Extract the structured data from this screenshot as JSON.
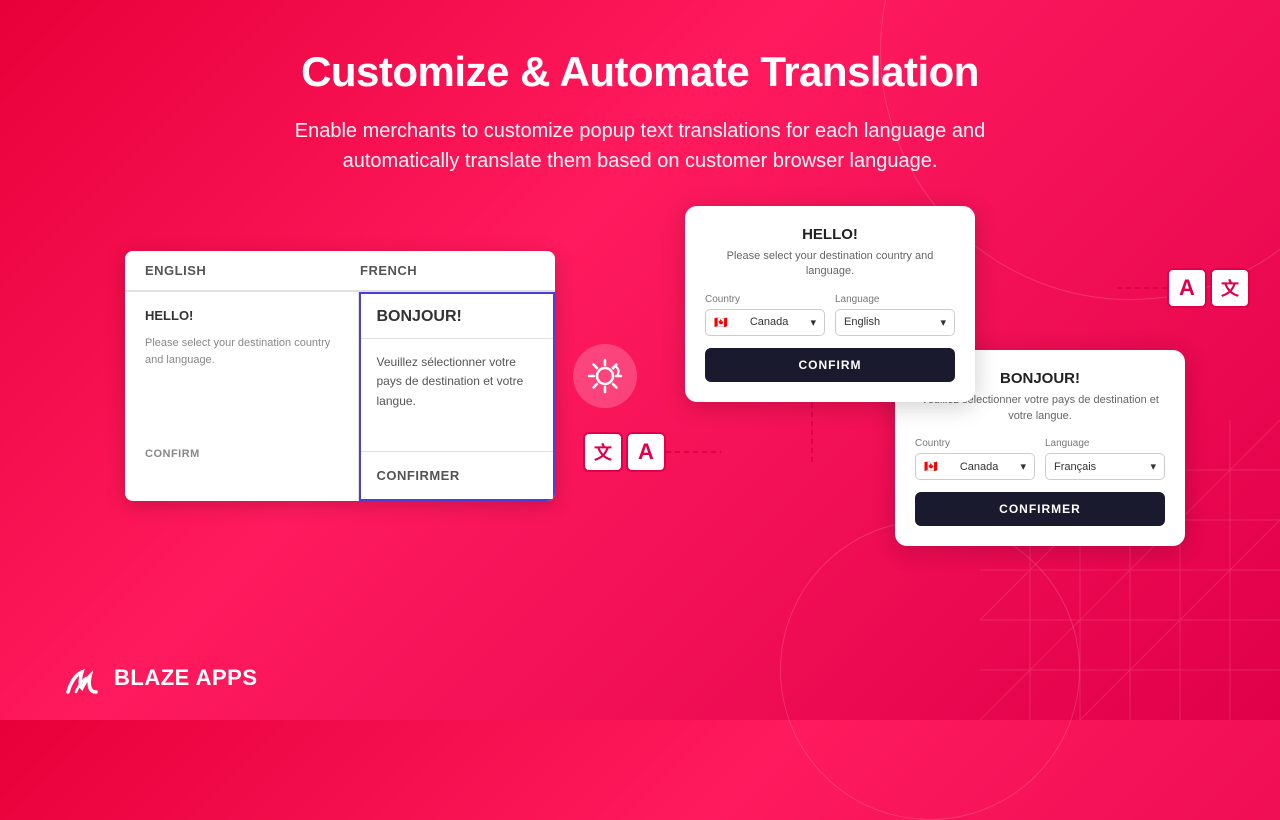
{
  "header": {
    "title": "Customize & Automate Translation",
    "subtitle": "Enable merchants to customize popup text translations for each language and\nautomatically translate them based on customer browser language."
  },
  "table": {
    "tab_english": "ENGLISH",
    "tab_french": "FRENCH",
    "english": {
      "hello": "HELLO!",
      "desc": "Please select your destination country and language.",
      "confirm": "CONFIRM"
    },
    "french": {
      "hello": "BONJOUR!",
      "desc": "Veuillez sélectionner votre pays de destination et votre langue.",
      "confirm": "CONFIRMER"
    }
  },
  "popup_english": {
    "title": "HELLO!",
    "subtitle": "Please select your destination country and language.",
    "country_label": "Country",
    "country_value": "Canada",
    "language_label": "Language",
    "language_value": "English",
    "confirm_btn": "CONFIRM"
  },
  "popup_french": {
    "title": "BONJOUR!",
    "subtitle": "Veuillez sélectionner votre pays de destination et votre langue.",
    "country_label": "Country",
    "country_value": "Canada",
    "language_label": "Language",
    "language_value": "Français",
    "confirm_btn": "CONFIRMER"
  },
  "logo": {
    "text": "BLAZE APPS"
  }
}
